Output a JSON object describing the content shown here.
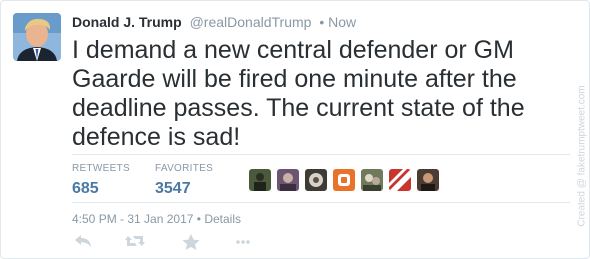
{
  "author": {
    "name": "Donald J. Trump",
    "handle": "@realDonaldTrump",
    "time_sep": "•",
    "time": "Now",
    "avatar_icon": "profile-photo"
  },
  "tweet": {
    "text": "I demand a new central defender or GM Gaarde will be fired one minute after the deadline passes. The current state of the defence is sad!"
  },
  "stats": {
    "retweets_label": "RETWEETS",
    "retweets_value": "685",
    "favorites_label": "FAVORITES",
    "favorites_value": "3547"
  },
  "favoriters": [
    {
      "icon": "user-avatar",
      "color": "#4b5a3a"
    },
    {
      "icon": "user-avatar",
      "color": "#6b5570"
    },
    {
      "icon": "user-avatar",
      "color": "#3e3a36"
    },
    {
      "icon": "user-avatar",
      "color": "#e8742c"
    },
    {
      "icon": "user-avatar",
      "color": "#6f7a5b"
    },
    {
      "icon": "user-avatar",
      "color": "#c9342f"
    },
    {
      "icon": "user-avatar",
      "color": "#4a3b33"
    }
  ],
  "footer": {
    "timestamp": "4:50 PM - 31 Jan 2017",
    "separator": "•",
    "details_label": "Details"
  },
  "actions": {
    "reply_icon": "reply-icon",
    "retweet_icon": "retweet-icon",
    "favorite_icon": "star-icon",
    "more_icon": "more-icon"
  },
  "watermark": "Created @ faketrumptweet.com",
  "colors": {
    "text": "#292f33",
    "muted": "#8899a6",
    "stat_value": "#4a79a3",
    "border": "#e1e8ed",
    "action_icon": "#ccd6dd"
  }
}
